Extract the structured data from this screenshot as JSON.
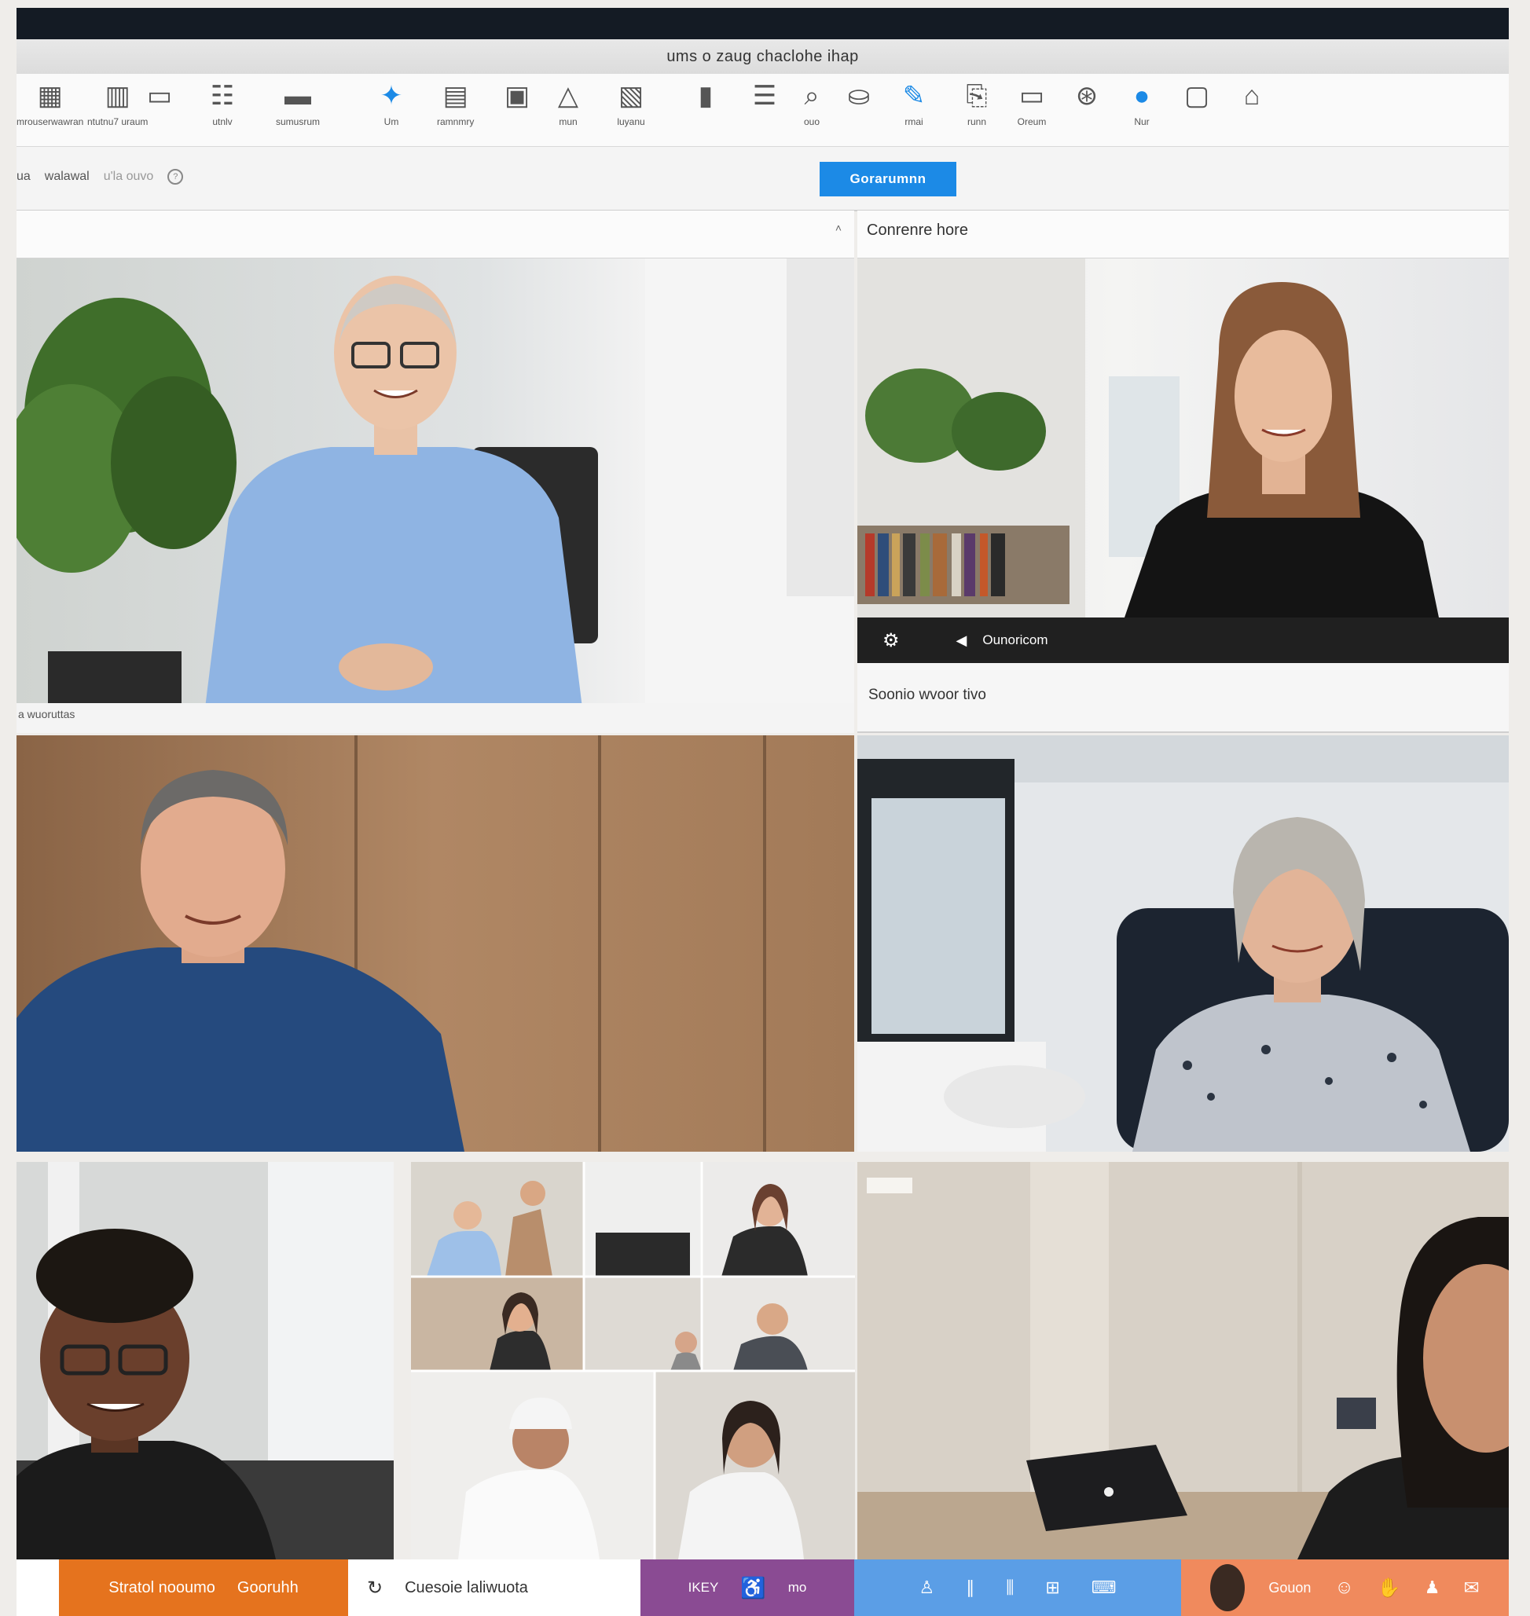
{
  "window": {
    "title": "ums o zaug chaclohe ihap"
  },
  "ribbon": {
    "items": [
      {
        "icon": "table-grid-icon",
        "label": "mrouserwawran"
      },
      {
        "icon": "layout-icon",
        "label": "ntutnu7 uraum"
      },
      {
        "icon": "chart-icon",
        "label": ""
      },
      {
        "icon": "list-box-icon",
        "label": "utnlv"
      },
      {
        "icon": "screen-icon",
        "label": "sumusrum"
      },
      {
        "icon": "blue-tag-icon",
        "label": "Um"
      },
      {
        "icon": "document-icon",
        "label": "ramnmry"
      },
      {
        "icon": "note-icon",
        "label": ""
      },
      {
        "icon": "shapes-icon",
        "label": "mun"
      },
      {
        "icon": "gallery-icon",
        "label": "luyanu"
      },
      {
        "icon": "panel-icon",
        "label": ""
      },
      {
        "icon": "lines-icon",
        "label": ""
      },
      {
        "icon": "search-icon",
        "label": "ouo"
      },
      {
        "icon": "stamp-icon",
        "label": ""
      },
      {
        "icon": "blue-pin-icon",
        "label": "rmai"
      },
      {
        "icon": "clip-icon",
        "label": "runn"
      },
      {
        "icon": "monitor-icon",
        "label": "Oreum"
      },
      {
        "icon": "compass-icon",
        "label": ""
      },
      {
        "icon": "blue-dot-icon",
        "label": "Nur"
      },
      {
        "icon": "card-icon",
        "label": ""
      },
      {
        "icon": "laptop-icon",
        "label": ""
      }
    ]
  },
  "command": {
    "left_a": "ua",
    "left_b": "walawal",
    "left_c": "u'la ouvo",
    "primary_button": "Gorarumnn"
  },
  "tiles": {
    "t1": {
      "header": "",
      "footer": "a wuoruttas"
    },
    "t2": {
      "header": "Conrenre hore",
      "caption": "Ounoricom",
      "footer": "Soonio wvoor tivo"
    },
    "t3": {},
    "t4": {},
    "t5": {},
    "t6": {},
    "t7": {}
  },
  "bottombar": {
    "seg1": "",
    "seg2a": "Stratol nooumo",
    "seg2b": "Gooruhh",
    "seg3": "Cuesoie laliwuota",
    "seg4": "IKEY",
    "seg4b": "mo",
    "seg6": "Gouon"
  },
  "colors": {
    "accent": "#1c8ae6",
    "bar_orange": "#e5731e",
    "bar_purple": "#8a4b93",
    "bar_blue": "#5b9ee6",
    "bar_salmon": "#f08a5d"
  }
}
